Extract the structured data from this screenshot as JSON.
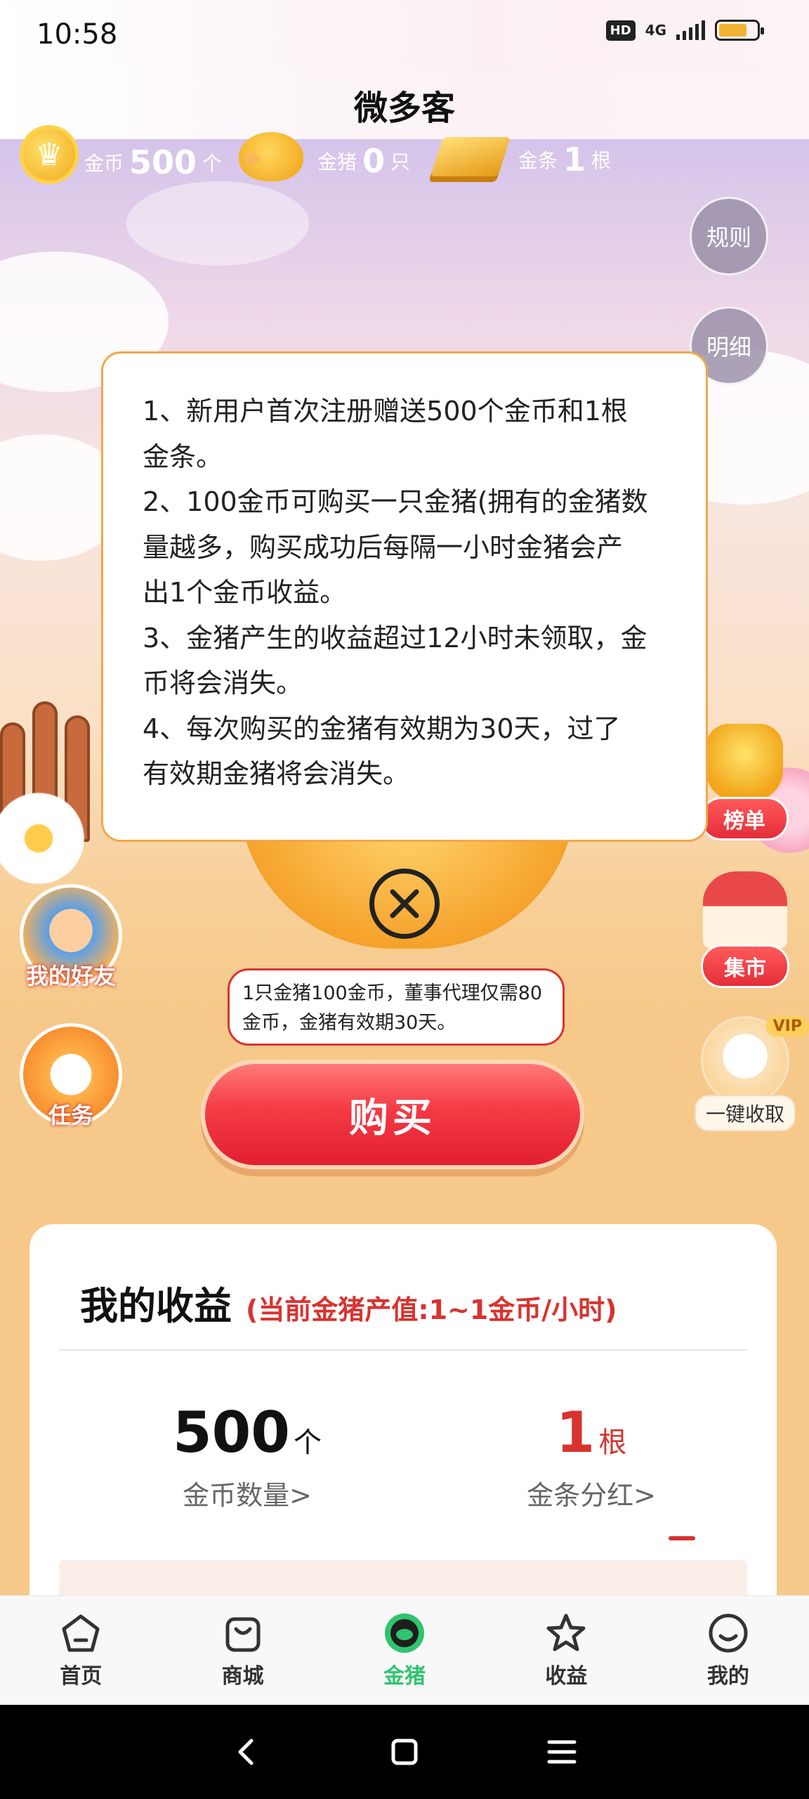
{
  "status_bar": {
    "time": "10:58",
    "hd": "HD",
    "network": "4G",
    "battery_level": 0.75
  },
  "header": {
    "title": "微多客"
  },
  "resources": {
    "coins": {
      "label": "金币",
      "value": "500",
      "unit": "个",
      "icon": "crown-coin-icon"
    },
    "pigs": {
      "label": "金猪",
      "value": "0",
      "unit": "只",
      "icon": "gold-pig-icon"
    },
    "bars": {
      "label": "金条",
      "value": "1",
      "unit": "根",
      "icon": "gold-bar-icon"
    }
  },
  "side_buttons": {
    "rules": "规则",
    "details": "明细"
  },
  "widgets": {
    "ranking": "榜单",
    "market": "集市",
    "vip_badge": "VIP",
    "collect_all": "一键收取",
    "friends": "我的好友",
    "tasks": "任务"
  },
  "rules_popup": {
    "lines": [
      "1、新用户首次注册赠送500个金币和1根",
      "金条。",
      "2、100金币可购买一只金猪(拥有的金猪数",
      "量越多，购买成功后每隔一小时金猪会产",
      "出1个金币收益。",
      "3、金猪产生的收益超过12小时未领取，金",
      "币将会消失。",
      "4、每次购买的金猪有效期为30天，过了",
      "有效期金猪将会消失。"
    ]
  },
  "note": {
    "line1": "1只金猪100金币，董事代理仅需80",
    "line2": "金币，金猪有效期30天。"
  },
  "buy_button": "购买",
  "earnings": {
    "title": "我的收益",
    "subtitle": "(当前金猪产值:1~1金币/小时)",
    "coins": {
      "value": "500",
      "unit": "个",
      "label": "金币数量>"
    },
    "bars": {
      "value": "1",
      "unit": "根",
      "label": "金条分红>"
    }
  },
  "bottom_nav": [
    {
      "label": "首页",
      "icon": "home-icon"
    },
    {
      "label": "商城",
      "icon": "shopping-bag-icon"
    },
    {
      "label": "金猪",
      "icon": "gold-pig-icon",
      "active": true
    },
    {
      "label": "收益",
      "icon": "star-icon"
    },
    {
      "label": "我的",
      "icon": "smile-icon"
    }
  ],
  "colors": {
    "accent_red": "#d8332f",
    "active_green": "#2fc46e",
    "popup_border": "#f0a84a"
  }
}
